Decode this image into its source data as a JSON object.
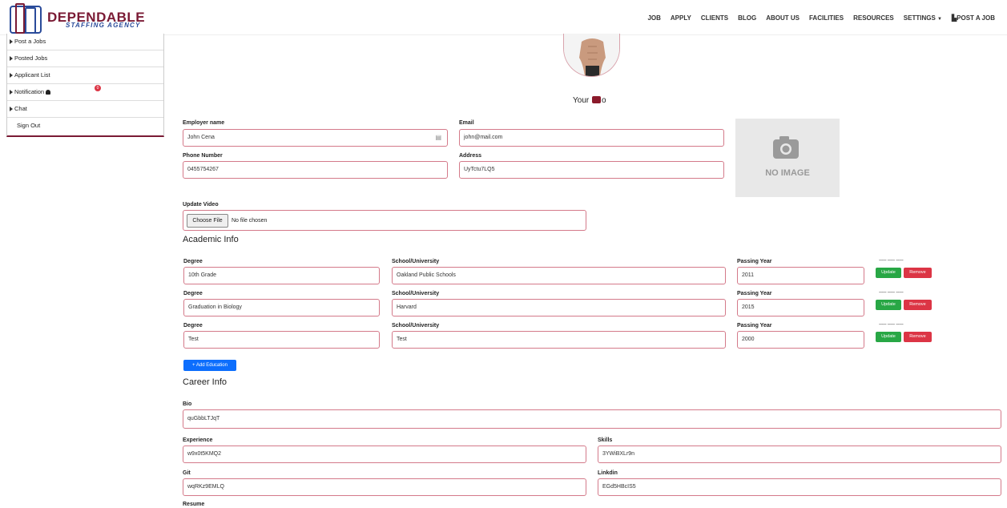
{
  "brand": {
    "name": "DEPENDABLE",
    "tagline": "STAFFING AGENCY",
    "color": "#7a1a34",
    "tagline_color": "#2a4b9a"
  },
  "nav": {
    "items": [
      "JOB",
      "APPLY",
      "CLIENTS",
      "BLOG",
      "ABOUT US",
      "FACILITIES",
      "RESOURCES",
      "SETTINGS"
    ],
    "post_job": "POST A JOB"
  },
  "sidebar": {
    "items": [
      {
        "label": "Post a Jobs"
      },
      {
        "label": "Posted Jobs"
      },
      {
        "label": "Applicant List"
      },
      {
        "label": "Notification"
      },
      {
        "label": "Chat"
      },
      {
        "label": "Sign Out"
      }
    ],
    "notification_count": "0"
  },
  "profile": {
    "photo_label_pre": "Your ",
    "photo_label_post": "o",
    "employer_name_label": "Employer name",
    "employer_name": "John Cena",
    "email_label": "Email",
    "email": "john@mail.com",
    "phone_label": "Phone Number",
    "phone": "0455754267",
    "address_label": "Address",
    "address": "UyTctu7LQ5",
    "no_image": "NO IMAGE",
    "video_label": "Update Video",
    "choose_file": "Choose File",
    "no_file": "No file chosen"
  },
  "academic": {
    "title": "Academic Info",
    "degree_label": "Degree",
    "school_label": "School/University",
    "year_label": "Passing Year",
    "placeholder_dashes": "----- ----- -----",
    "update": "Update",
    "remove": "Remove",
    "add": "Add Education",
    "rows": [
      {
        "degree": "10th Grade",
        "school": "Oakland Public Schools",
        "year": "2011"
      },
      {
        "degree": "Graduation in Biology",
        "school": "Harvard",
        "year": "2015"
      },
      {
        "degree": "Test",
        "school": "Test",
        "year": "2000"
      }
    ]
  },
  "career": {
    "title": "Career Info",
    "bio_label": "Bio",
    "bio": "quGbbLTJqT",
    "experience_label": "Experience",
    "experience": "w9x0t5KMQ2",
    "skills_label": "Skills",
    "skills": "3YWiBXLr9n",
    "git_label": "Git",
    "git": "wqRKz9EMLQ",
    "linkedin_label": "Linkdin",
    "linkedin": "EGd5HBcIS5",
    "resume_label": "Resume"
  },
  "colors": {
    "accent": "#7a1a34",
    "input_border": "#d47a8a",
    "update": "#28a745",
    "remove": "#dc3545",
    "add": "#0d6efd"
  }
}
